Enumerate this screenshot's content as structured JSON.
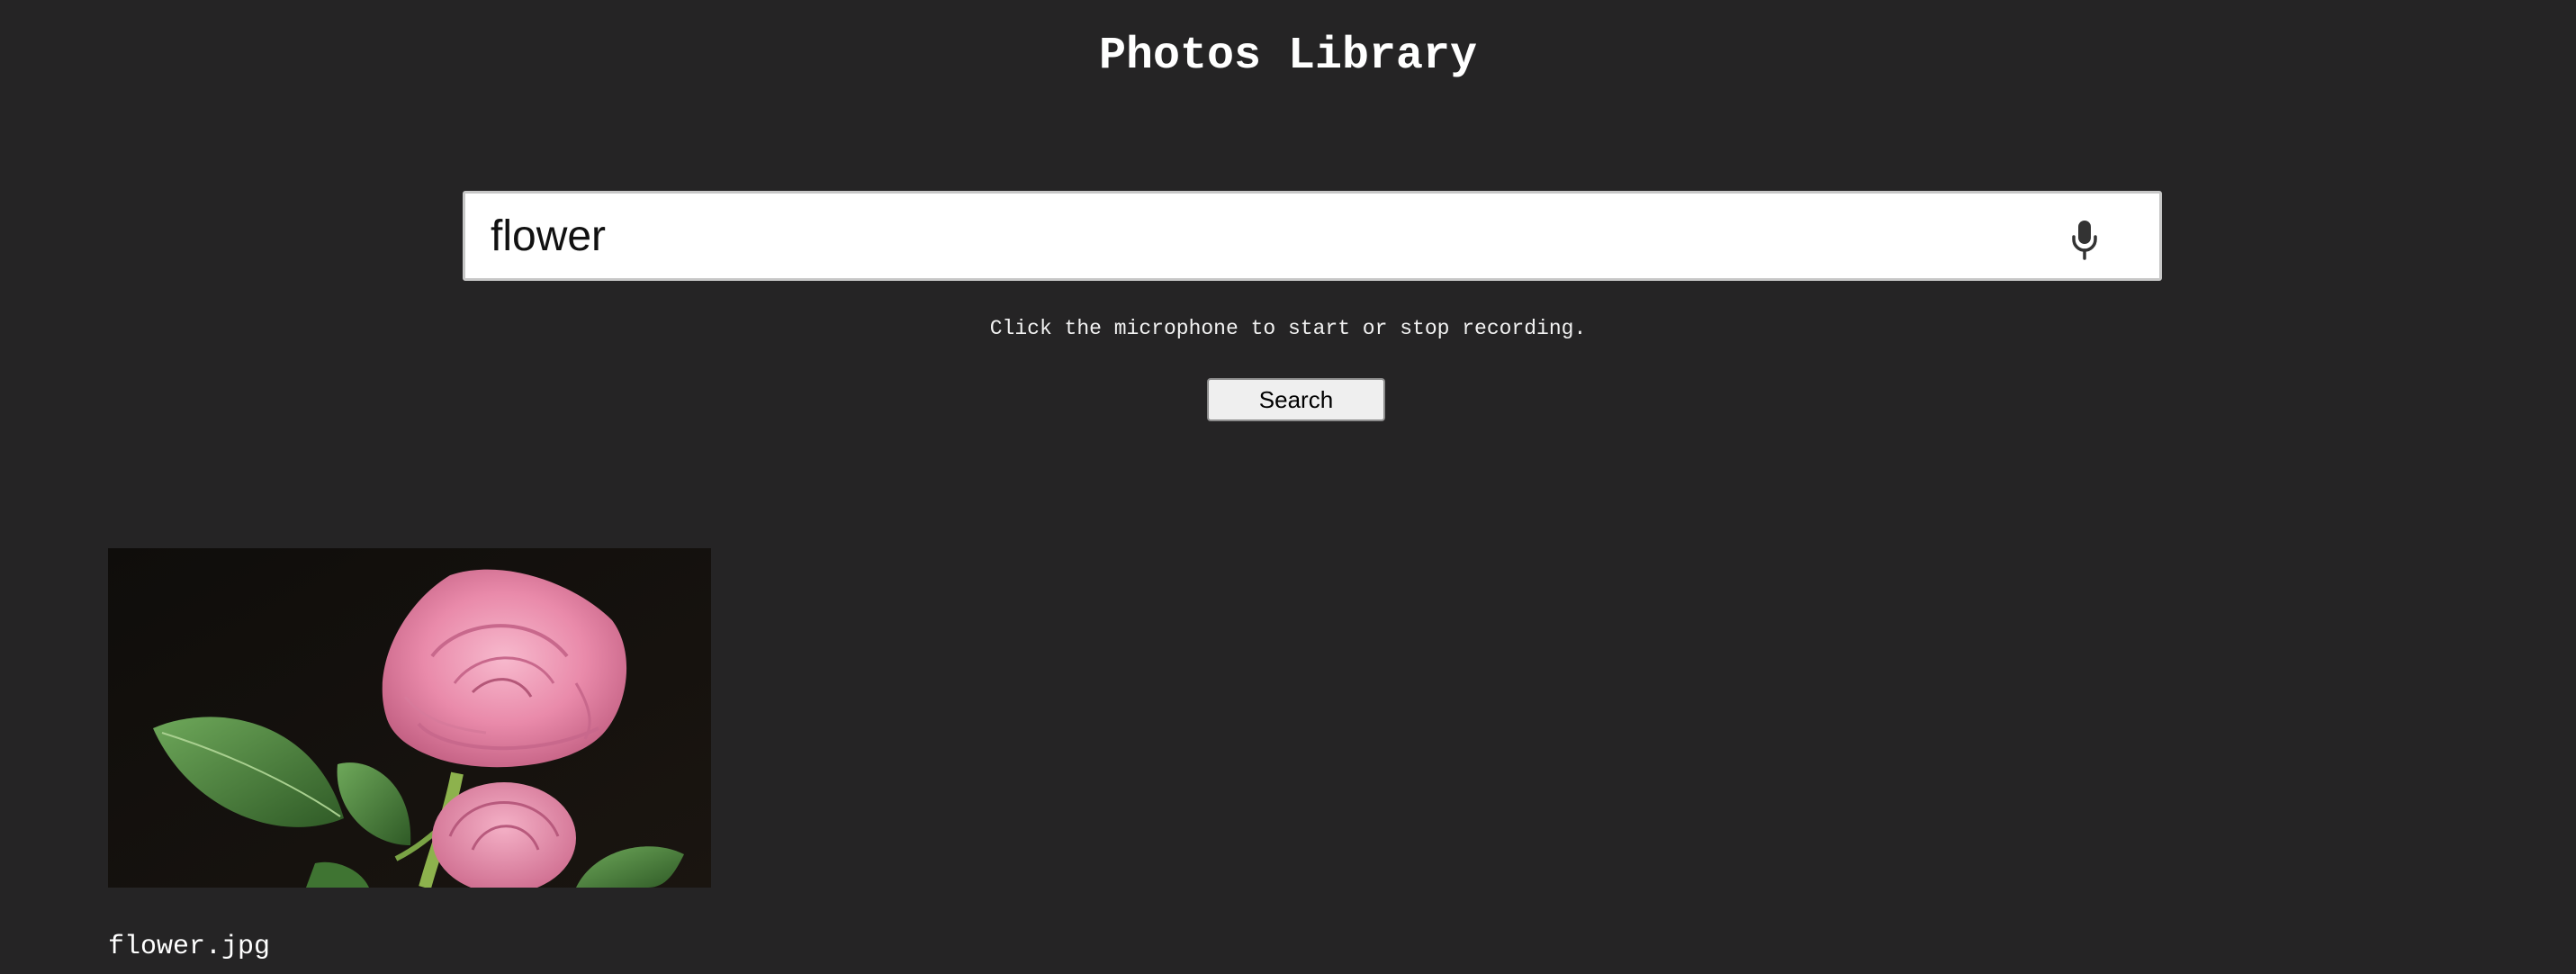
{
  "page": {
    "title": "Photos Library"
  },
  "search": {
    "value": "flower",
    "hint": "Click the microphone to start or stop recording.",
    "button_label": "Search",
    "mic_icon": "microphone-icon"
  },
  "results": [
    {
      "filename": "flower.jpg",
      "image_subject": "pink-rose-photo"
    }
  ],
  "colors": {
    "background": "#252425",
    "title_text": "#ffffff",
    "search_field": "#ffffff",
    "button": "#efefef",
    "rose": "#e98aaa",
    "leaf": "#4f8a3e"
  }
}
